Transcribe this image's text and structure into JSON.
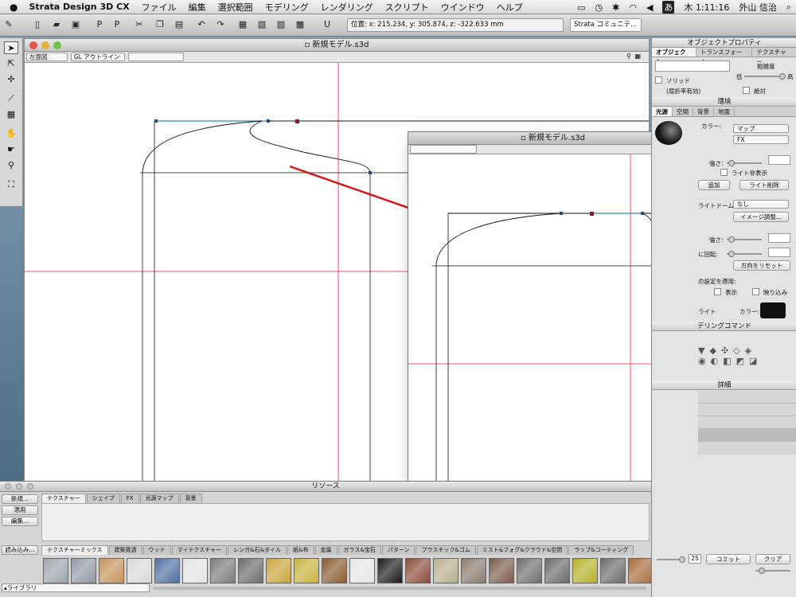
{
  "menubar": {
    "app_name": "Strata Design 3D CX",
    "items": [
      "ファイル",
      "編集",
      "選択範囲",
      "モデリング",
      "レンダリング",
      "スクリプト",
      "ウインドウ",
      "ヘルプ"
    ],
    "input_method": "あ",
    "clock": "木 1:11:16",
    "user": "外山 信治"
  },
  "toolbar": {
    "coords": "位置: x: 215.234, y: 305.874, z: -322.633 mm",
    "community": "Strata コミュニテ..."
  },
  "main_window": {
    "title": "新規モデル.s3d",
    "view_select": "左面図",
    "render_select": "GL アウトライン"
  },
  "float_window": {
    "title": "新規モデル.s3d"
  },
  "object_panel": {
    "title": "オブジェクトプロパティ",
    "tabs": [
      "オブジェクト",
      "トランスフォーム",
      "テクスチャー"
    ],
    "roughness_label": "粗雑度",
    "low_label": "低",
    "high_label": "高",
    "solid_label": "ソリッド",
    "refraction_label": "(屈折率有効)",
    "absolute_label": "絶対"
  },
  "env_panel": {
    "title": "環境",
    "tabs": [
      "光源",
      "空間",
      "背景",
      "地面"
    ],
    "color_label": "カラー:",
    "map_select": "マップ",
    "fx_select": "FX",
    "intensity_label": "強さ:",
    "hide_light_label": "ライト非表示",
    "add_button": "追加",
    "delete_light_button": "ライト削除",
    "light_dome_label": "ライトドーム:",
    "light_dome_select": "なし",
    "image_adjust_button": "イメージ調整...",
    "intensity2_label": "強さ:",
    "rotate_label": "に回転:",
    "reset_direction_button": "方向をリセット",
    "apply_settings_label": "の設定を適用:",
    "display_label": "表示",
    "reflection_label": "映り込み",
    "light_label": "ライト",
    "color2_label": "カラー:"
  },
  "modeling_panel": {
    "title": "デリングコマンド"
  },
  "detail_panel": {
    "title": "詳細",
    "value": "25",
    "commit_button": "コミット",
    "clear_button": "クリア"
  },
  "resource_panel": {
    "title": "リソース",
    "buttons": [
      "新規...",
      "適用",
      "編集...",
      "読み込み..."
    ],
    "top_tabs": [
      "テクスチャー",
      "シェイプ",
      "FX",
      "光源マップ",
      "背景"
    ],
    "bottom_tabs": [
      "テクスチャーミックス",
      "建築質透",
      "ウッド",
      "マイテクスチャー",
      "レンガ&石&タイル",
      "紙&布",
      "金属",
      "ガラス&宝石",
      "パターン",
      "プラスチック&ゴム",
      "ミスト&フォグ&クラウド&空間",
      "ラップ&コーティング"
    ],
    "library_label": "▴ライブラリ",
    "swatch_colors": [
      "#9aa4ad",
      "#8e9aa6",
      "#c4925a",
      "#d9d9d9",
      "#4d6ea0",
      "#e2e4e6",
      "#7a7a7a",
      "#6b6b6b",
      "#c9a23a",
      "#c8b23c",
      "#8a5a2f",
      "#e6e6e6",
      "#1a1a1a",
      "#8a4a3a",
      "#b8ad8e",
      "#8a7a6a",
      "#7a5a4a",
      "#6e6e6e",
      "#6a6a6a",
      "#b6b02a",
      "#6a6a6a",
      "#a86a3a",
      "#9a6a7a"
    ]
  }
}
